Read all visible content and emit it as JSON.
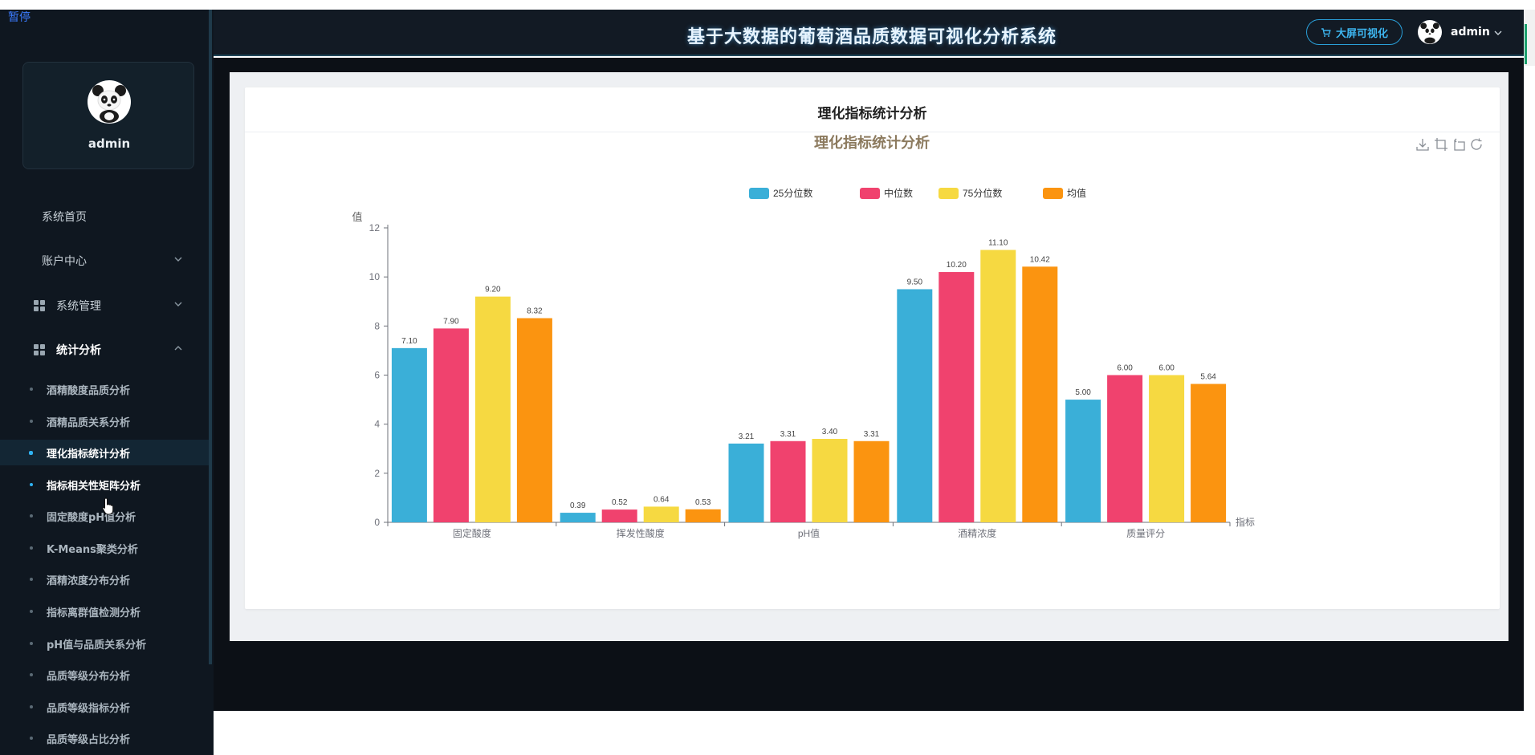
{
  "overlay": {
    "pause_label": "暂停"
  },
  "header": {
    "title": "基于大数据的葡萄酒品质数据可视化分析系统",
    "bigscreen_label": "大屏可视化",
    "username": "admin"
  },
  "profile": {
    "name": "admin"
  },
  "sidebar": {
    "menu": [
      {
        "label": "系统首页"
      },
      {
        "label": "账户中心"
      },
      {
        "label": "系统管理"
      },
      {
        "label": "统计分析"
      }
    ],
    "submenu": [
      {
        "label": "酒精酸度品质分析"
      },
      {
        "label": "酒精品质关系分析"
      },
      {
        "label": "理化指标统计分析"
      },
      {
        "label": "指标相关性矩阵分析"
      },
      {
        "label": "固定酸度pH值分析"
      },
      {
        "label": "K-Means聚类分析"
      },
      {
        "label": "酒精浓度分布分析"
      },
      {
        "label": "指标离群值检测分析"
      },
      {
        "label": "pH值与品质关系分析"
      },
      {
        "label": "品质等级分布分析"
      },
      {
        "label": "品质等级指标分析"
      },
      {
        "label": "品质等级占比分析"
      }
    ],
    "active_submenu": "理化指标统计分析"
  },
  "card": {
    "title": "理化指标统计分析"
  },
  "colors": {
    "accent": "#2fb3f3",
    "sidebar_bg": "#0f1720",
    "header_bg": "#121a24"
  },
  "chart_data": {
    "type": "bar",
    "title": "理化指标统计分析",
    "xlabel": "指标",
    "ylabel": "值",
    "ylim": [
      0,
      12
    ],
    "yticks": [
      0,
      2,
      4,
      6,
      8,
      10,
      12
    ],
    "grid": false,
    "legend_position": "top-center",
    "categories": [
      "固定酸度",
      "挥发性酸度",
      "pH值",
      "酒精浓度",
      "质量评分"
    ],
    "series": [
      {
        "name": "25分位数",
        "color": "#3aafd8",
        "values": [
          7.1,
          0.39,
          3.21,
          9.5,
          5.0
        ],
        "labels": [
          "7.10",
          "0.39",
          "3.21",
          "9.50",
          "5.00"
        ]
      },
      {
        "name": "中位数",
        "color": "#f0426e",
        "values": [
          7.9,
          0.52,
          3.31,
          10.2,
          6.0
        ],
        "labels": [
          "7.90",
          "0.52",
          "3.31",
          "10.20",
          "6.00"
        ]
      },
      {
        "name": "75分位数",
        "color": "#f6d941",
        "values": [
          9.2,
          0.64,
          3.4,
          11.1,
          6.0
        ],
        "labels": [
          "9.20",
          "0.64",
          "3.40",
          "11.10",
          "6.00"
        ]
      },
      {
        "name": "均值",
        "color": "#fb9410",
        "values": [
          8.32,
          0.53,
          3.31,
          10.42,
          5.64
        ],
        "labels": [
          "8.32",
          "0.53",
          "3.31",
          "10.42",
          "5.64"
        ]
      }
    ]
  }
}
